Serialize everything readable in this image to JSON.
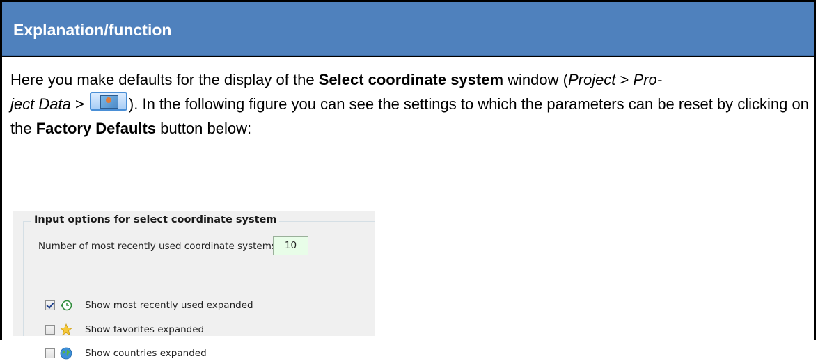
{
  "header": {
    "title": "Explanation/function"
  },
  "paragraph": {
    "t1": "Here you make defaults for the display of the ",
    "b1": "Select coordinate system",
    "t2": " window (",
    "i1": "Project",
    "t3": " > ",
    "i2": "Pro-",
    "i3": "ject Data",
    "t4": " > ",
    "t5": "). In the following figure you can see the settings to which the parameters can be reset by clicking on the ",
    "b2": "Factory Defaults",
    "t6": " button below:"
  },
  "panel": {
    "group_title": "Input options for select coordinate system",
    "count_label": "Number of most recently used coordinate systems:",
    "count_value": "10",
    "options": [
      {
        "label": "Show most recently used expanded",
        "checked": true,
        "icon": "recent-clock-icon"
      },
      {
        "label": "Show favorites expanded",
        "checked": false,
        "icon": "star-icon"
      },
      {
        "label": "Show countries expanded",
        "checked": false,
        "icon": "globe-icon"
      }
    ]
  }
}
